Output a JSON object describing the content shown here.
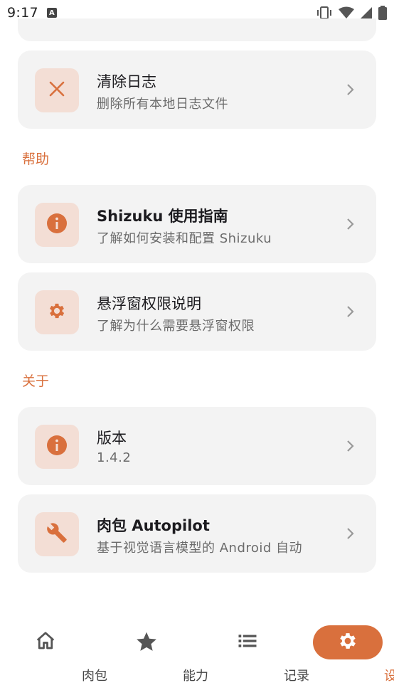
{
  "status_bar": {
    "time": "9:17",
    "indicator": "A"
  },
  "log_section": {
    "clear_logs": {
      "title": "清除日志",
      "subtitle": "删除所有本地日志文件",
      "icon": "close-icon"
    }
  },
  "help_section": {
    "header": "帮助",
    "items": [
      {
        "title": "Shizuku 使用指南",
        "subtitle": "了解如何安装和配置 Shizuku",
        "icon": "info-icon"
      },
      {
        "title": "悬浮窗权限说明",
        "subtitle": "了解为什么需要悬浮窗权限",
        "icon": "gear-icon"
      }
    ]
  },
  "about_section": {
    "header": "关于",
    "items": [
      {
        "title": "版本",
        "subtitle": "1.4.2",
        "icon": "info-icon"
      },
      {
        "title": "肉包 Autopilot",
        "subtitle": "基于视觉语言模型的 Android 自动",
        "icon": "wrench-icon"
      }
    ]
  },
  "bottom_nav": {
    "items": [
      {
        "label": "肉包",
        "icon": "home-icon",
        "active": false
      },
      {
        "label": "能力",
        "icon": "star-icon",
        "active": false
      },
      {
        "label": "记录",
        "icon": "list-icon",
        "active": false
      },
      {
        "label": "设置",
        "icon": "gear-icon",
        "active": true
      }
    ]
  },
  "colors": {
    "accent": "#d9703d",
    "icon_bg": "#f3ded5",
    "card_bg": "#f3f3f3"
  }
}
